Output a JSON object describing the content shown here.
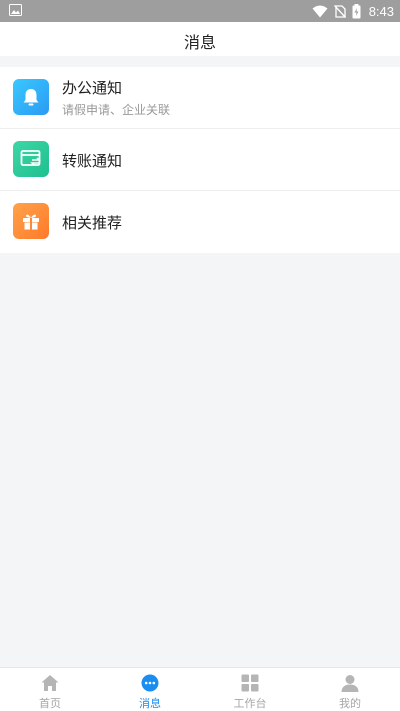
{
  "status_bar": {
    "time": "8:43",
    "icons": [
      "image-icon",
      "wifi-icon",
      "no-sim-icon",
      "battery-charging-icon"
    ]
  },
  "header": {
    "title": "消息"
  },
  "messages": [
    {
      "label": "办公通知",
      "subtitle": "请假申请、企业关联",
      "icon": "bell-icon",
      "color": "#2ba8f7"
    },
    {
      "label": "转账通知",
      "icon": "wallet-transfer-icon",
      "color": "#25c99a"
    },
    {
      "label": "相关推荐",
      "icon": "gift-icon",
      "color": "#ff8a35"
    }
  ],
  "tabbar": {
    "tabs": [
      {
        "label": "首页",
        "icon": "home-icon",
        "active": false
      },
      {
        "label": "消息",
        "icon": "chat-bubble-icon",
        "active": true
      },
      {
        "label": "工作台",
        "icon": "grid-icon",
        "active": false
      },
      {
        "label": "我的",
        "icon": "user-icon",
        "active": false
      }
    ],
    "active_color": "#1a8df0",
    "inactive_color": "#a6a6a6"
  }
}
